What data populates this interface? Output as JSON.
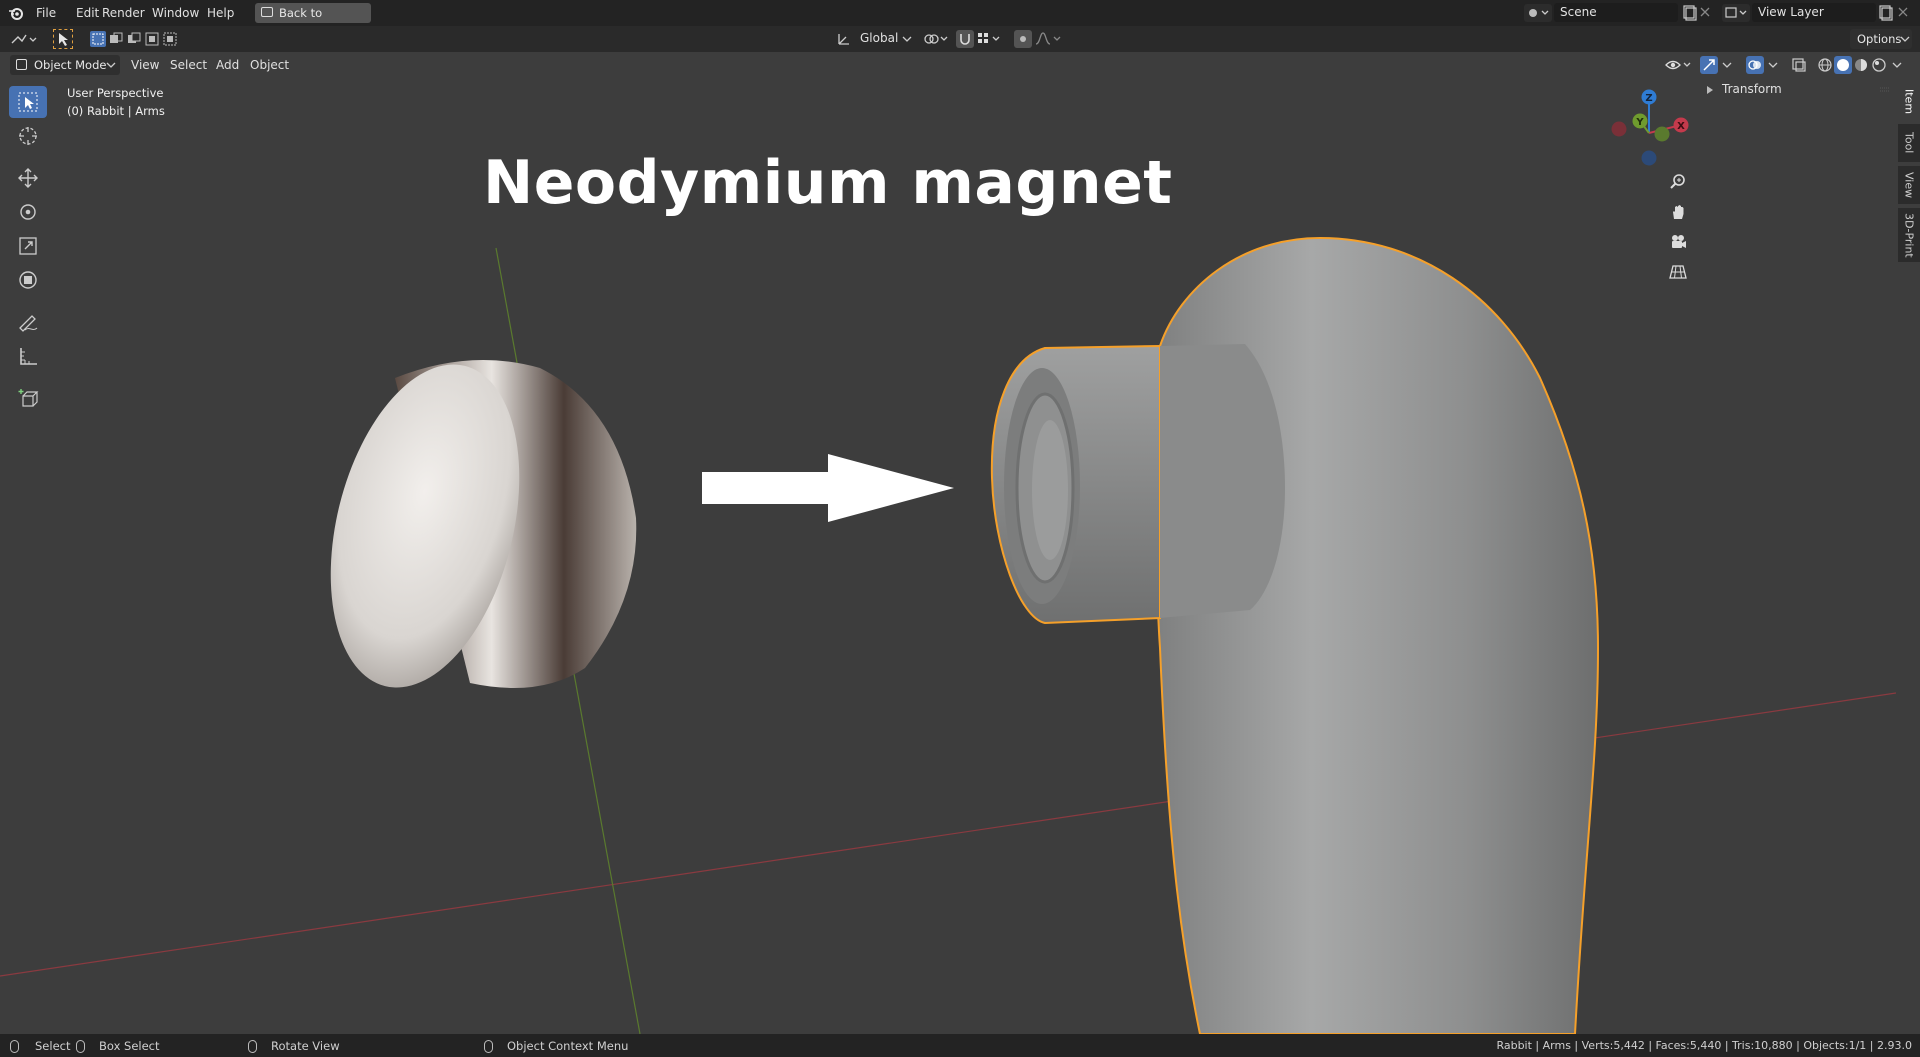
{
  "top_menu": {
    "file": "File",
    "edit": "Edit",
    "render": "Render",
    "window": "Window",
    "help": "Help",
    "back_to_previous": "Back to Previous",
    "scene_value": "Scene",
    "view_layer_value": "View Layer"
  },
  "header": {
    "mode": "Object Mode",
    "view": "View",
    "select": "Select",
    "add": "Add",
    "object": "Object",
    "transform_orientation": "Global",
    "options": "Options"
  },
  "viewport": {
    "perspective_label": "User Perspective",
    "collection_label": "(0) Rabbit | Arms",
    "annotation_title": "Neodymium magnet",
    "gizmo": {
      "z": "Z",
      "y": "Y",
      "x": "X"
    }
  },
  "sidebar": {
    "panel_title": "Transform",
    "tabs": [
      "Item",
      "Tool",
      "View",
      "3D-Print"
    ]
  },
  "statusbar": {
    "select": "Select",
    "box_select": "Box Select",
    "rotate_view": "Rotate View",
    "context_menu": "Object Context Menu",
    "stats": "Rabbit | Arms | Verts:5,442 | Faces:5,440 | Tris:10,880 | Objects:1/1 | 2.93.0"
  },
  "colors": {
    "active_tool": "#4772b3",
    "selection_outline": "#f5a02a",
    "x_axis": "#c43a4c",
    "y_axis": "#6f9b2e",
    "z_axis": "#2f7cd4"
  }
}
